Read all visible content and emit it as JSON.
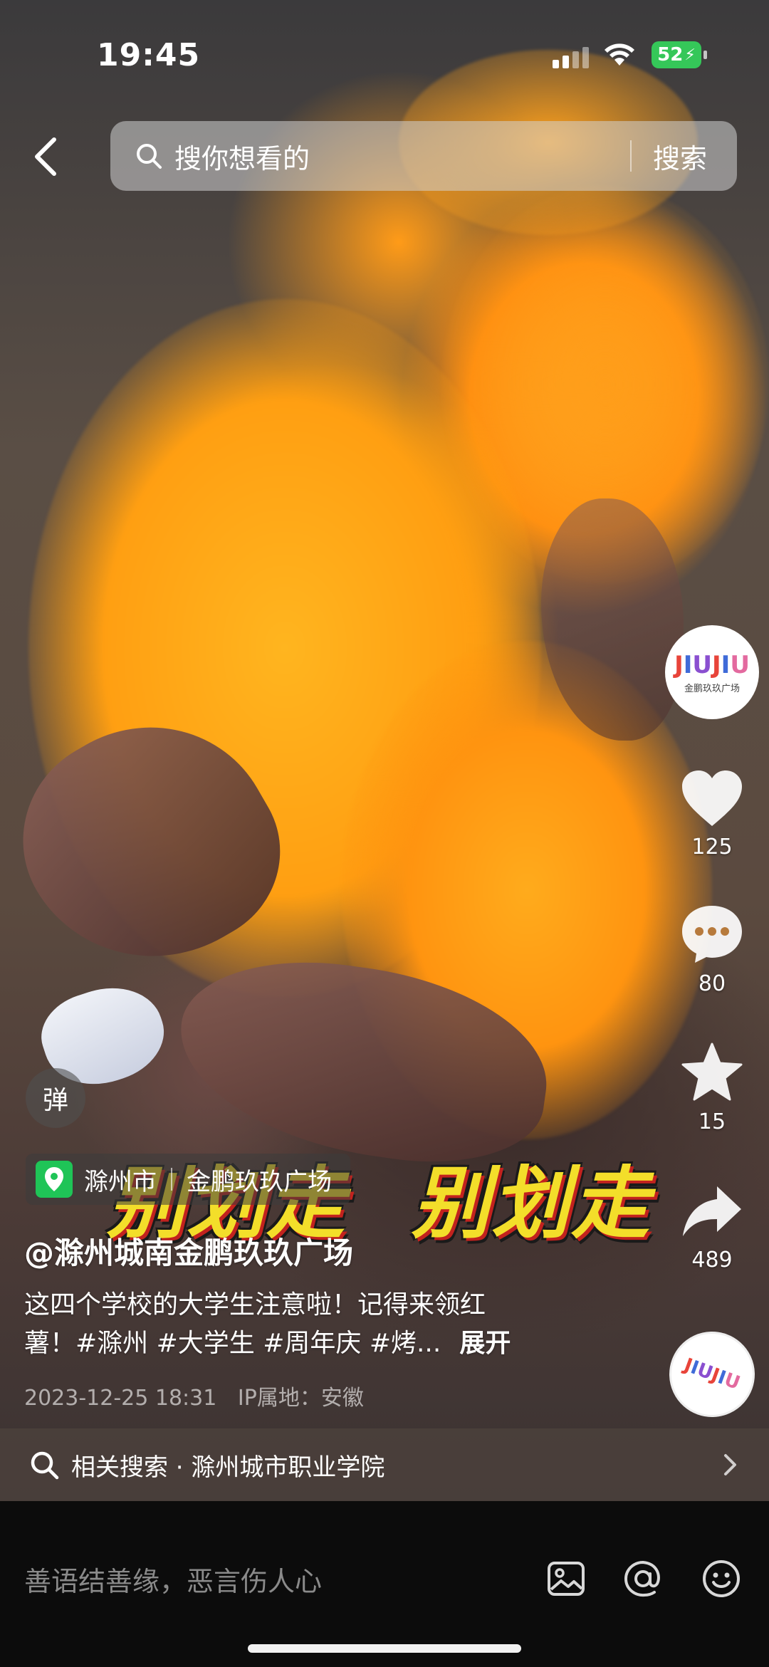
{
  "status_bar": {
    "time": "19:45",
    "battery": "52"
  },
  "top_search": {
    "placeholder": "搜你想看的",
    "button": "搜索"
  },
  "account": {
    "logo_text": "JIUJIU",
    "logo_sub": "金鹏玖玖广场"
  },
  "actions": {
    "likes": "125",
    "comments": "80",
    "favorites": "15",
    "shares": "489"
  },
  "danmaku": {
    "label": "弹"
  },
  "video_subtitle": {
    "left": "别划走",
    "right": "别划走"
  },
  "location": {
    "city": "滁州市",
    "place": "金鹏玖玖广场"
  },
  "post": {
    "author": "@滁州城南金鹏玖玖广场",
    "description_line1": "这四个学校的大学生注意啦！记得来领红",
    "description_line2": "薯！#滁州 #大学生 #周年庆 #烤...",
    "expand": "展开",
    "date": "2023-12-25 18:31",
    "ip": "IP属地：安徽"
  },
  "related_search": {
    "text": "相关搜索 · 滁州城市职业学院"
  },
  "comment_bar": {
    "placeholder": "善语结善缘，恶言伤人心"
  }
}
